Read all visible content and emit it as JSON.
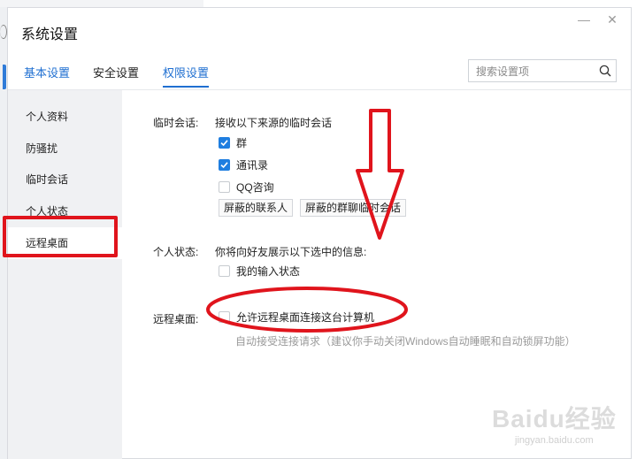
{
  "window": {
    "title": "系统设置",
    "minimize_glyph": "—",
    "close_glyph": "✕"
  },
  "tabs": [
    {
      "label": "基本设置",
      "state": "highlighted"
    },
    {
      "label": "安全设置",
      "state": "normal"
    },
    {
      "label": "权限设置",
      "state": "active"
    }
  ],
  "search": {
    "placeholder": "搜索设置项",
    "value": "",
    "icon": "search-icon"
  },
  "sidebar": {
    "items": [
      {
        "label": "个人资料"
      },
      {
        "label": "防骚扰"
      },
      {
        "label": "临时会话"
      },
      {
        "label": "个人状态"
      },
      {
        "label": "远程桌面",
        "active": true
      }
    ]
  },
  "temp_session": {
    "label": "临时会话:",
    "description": "接收以下来源的临时会话",
    "options": [
      {
        "label": "群",
        "checked": true
      },
      {
        "label": "通讯录",
        "checked": true
      },
      {
        "label": "QQ咨询",
        "checked": false
      }
    ],
    "buttons": [
      "屏蔽的联系人",
      "屏蔽的群聊临时会话"
    ]
  },
  "personal_status": {
    "label": "个人状态:",
    "description": "你将向好友展示以下选中的信息:",
    "options": [
      {
        "label": "我的输入状态",
        "checked": false
      }
    ]
  },
  "remote_desktop": {
    "label": "远程桌面:",
    "options": [
      {
        "label": "允许远程桌面连接这台计算机",
        "checked": false
      }
    ],
    "sub_note": "自动接受连接请求（建议你手动关闭Windows自动睡眠和自动锁屏功能）"
  },
  "watermark": {
    "brand": "Baidu经验",
    "site": "jingyan.baidu.com"
  },
  "colors": {
    "accent": "#1f6fd1",
    "annotation_red": "#e0141c",
    "checkbox_checked": "#1f7ee0"
  }
}
